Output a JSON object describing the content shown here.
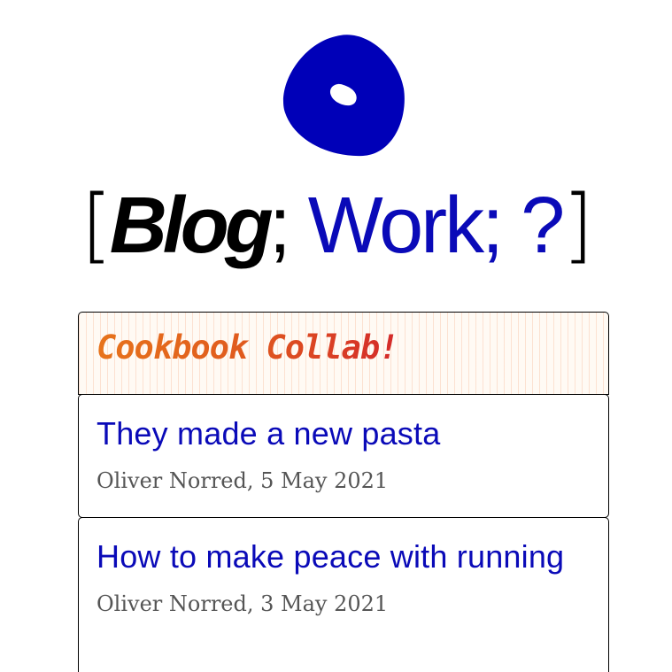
{
  "logo": {
    "icon": "blue-blob-logo-icon",
    "color": "#0000b8"
  },
  "nav": {
    "open_bracket": "[",
    "blog": "Blog",
    "sep1": ";",
    "work": "Work",
    "sep2": ";",
    "question": "?",
    "close_bracket": "]",
    "link_color": "#0a0ab8"
  },
  "section": {
    "title": "Cookbook Collab!"
  },
  "posts": [
    {
      "title": "They made a new pasta",
      "meta": "Oliver Norred, 5 May 2021"
    },
    {
      "title": "How to make peace with running",
      "meta": "Oliver Norred, 3 May 2021"
    }
  ]
}
